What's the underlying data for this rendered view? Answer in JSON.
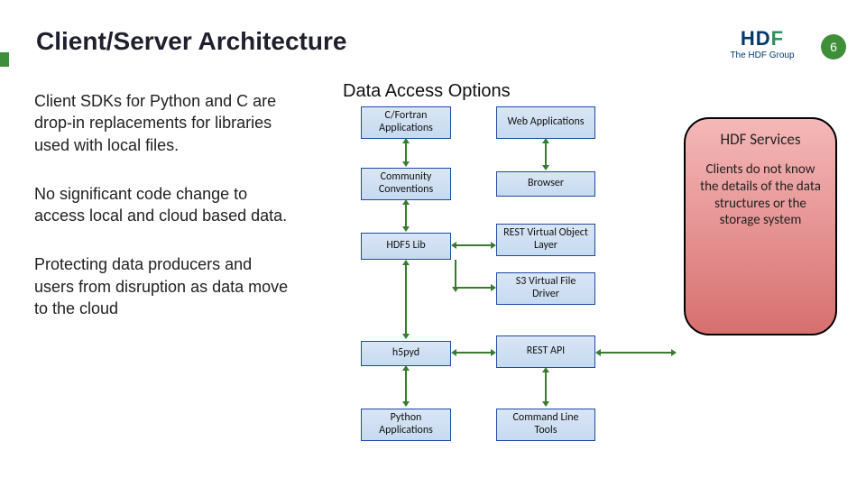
{
  "page": {
    "title": "Client/Server Architecture",
    "number": "6"
  },
  "logo": {
    "top_left": "HD",
    "top_right": "F",
    "sub": "The HDF Group"
  },
  "left": {
    "p1": "Client SDKs for Python and C are drop-in replacements for libraries used with local files.",
    "p2": "No significant code change to access local and cloud based data.",
    "p3": "Protecting data producers and users from disruption as data move to the cloud"
  },
  "diagram": {
    "heading": "Data Access Options",
    "boxes": {
      "cfortran": "C/Fortran Applications",
      "web": "Web Applications",
      "community": "Community Conventions",
      "browser": "Browser",
      "hdf5lib": "HDF5 Lib",
      "restvol": "REST Virtual Object Layer",
      "s3vfd": "S3 Virtual File Driver",
      "h5pyd": "h5pyd",
      "restapi": "REST API",
      "python": "Python Applications",
      "cli": "Command Line Tools"
    }
  },
  "services": {
    "title": "HDF Services",
    "note": "Clients do not know the details of the data structures or the storage system"
  }
}
